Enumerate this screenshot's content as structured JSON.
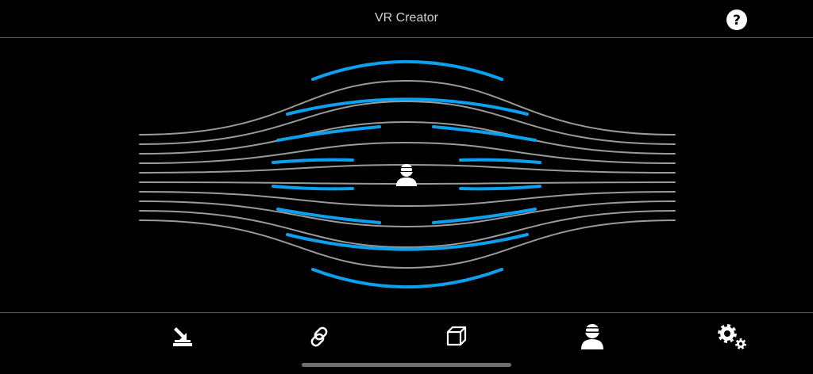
{
  "header": {
    "title": "VR Creator",
    "help_icon": "help-icon"
  },
  "toolbar": {
    "items": [
      {
        "id": "import",
        "icon": "import-icon"
      },
      {
        "id": "link",
        "icon": "link-icon"
      },
      {
        "id": "cube",
        "icon": "cube-icon"
      },
      {
        "id": "viewer",
        "icon": "vr-viewer-icon"
      },
      {
        "id": "settings",
        "icon": "settings-icon"
      }
    ]
  },
  "stage": {
    "center_icon": "vr-viewer-icon"
  },
  "colors": {
    "background": "#000000",
    "accent": "#0aa2f0",
    "line": "#9a9a9a",
    "icon": "#ffffff",
    "divider": "#5a5a5a"
  }
}
